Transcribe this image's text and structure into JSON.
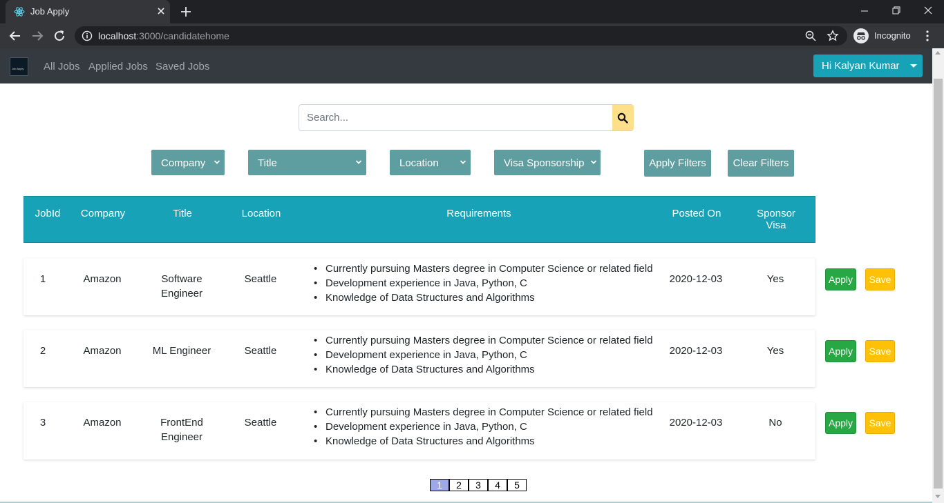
{
  "browser": {
    "tab_title": "Job Apply",
    "url_host": "localhost",
    "url_rest": ":3000/candidatehome",
    "profile_label": "Incognito"
  },
  "navbar": {
    "brand_text": "Job Apply",
    "links": [
      "All Jobs",
      "Applied Jobs",
      "Saved Jobs"
    ],
    "user_button": "Hi Kalyan Kumar"
  },
  "search": {
    "placeholder": "Search..."
  },
  "filters": {
    "company": "Company",
    "title": "Title",
    "location": "Location",
    "visa": "Visa Sponsorship",
    "apply": "Apply Filters",
    "clear": "Clear Filters"
  },
  "table": {
    "headers": {
      "jobid": "JobId",
      "company": "Company",
      "title": "Title",
      "location": "Location",
      "requirements": "Requirements",
      "posted": "Posted On",
      "sponsor_line1": "Sponsor",
      "sponsor_line2": "Visa"
    },
    "apply_label": "Apply",
    "save_label": "Save",
    "rows": [
      {
        "id": "1",
        "company": "Amazon",
        "title_l1": "Software",
        "title_l2": "Engineer",
        "location": "Seattle",
        "requirements": [
          "Currently pursuing Masters degree in Computer Science or related field",
          "Development experience in Java, Python, C",
          "Knowledge of Data Structures and Algorithms"
        ],
        "posted": "2020-12-03",
        "visa": "Yes"
      },
      {
        "id": "2",
        "company": "Amazon",
        "title_l1": "ML Engineer",
        "title_l2": "",
        "location": "Seattle",
        "requirements": [
          "Currently pursuing Masters degree in Computer Science or related field",
          "Development experience in Java, Python, C",
          "Knowledge of Data Structures and Algorithms"
        ],
        "posted": "2020-12-03",
        "visa": "Yes"
      },
      {
        "id": "3",
        "company": "Amazon",
        "title_l1": "FrontEnd",
        "title_l2": "Engineer",
        "location": "Seattle",
        "requirements": [
          "Currently pursuing Masters degree in Computer Science or related field",
          "Development experience in Java, Python, C",
          "Knowledge of Data Structures and Algorithms"
        ],
        "posted": "2020-12-03",
        "visa": "No"
      }
    ]
  },
  "pagination": {
    "pages": [
      "1",
      "2",
      "3",
      "4",
      "5"
    ],
    "active": "1"
  },
  "colors": {
    "navbar": "#343a40",
    "accent": "#17a2b8",
    "filter": "#5f9ea0",
    "apply": "#28a745",
    "save": "#ffc107",
    "search_button": "#ffe08a"
  }
}
